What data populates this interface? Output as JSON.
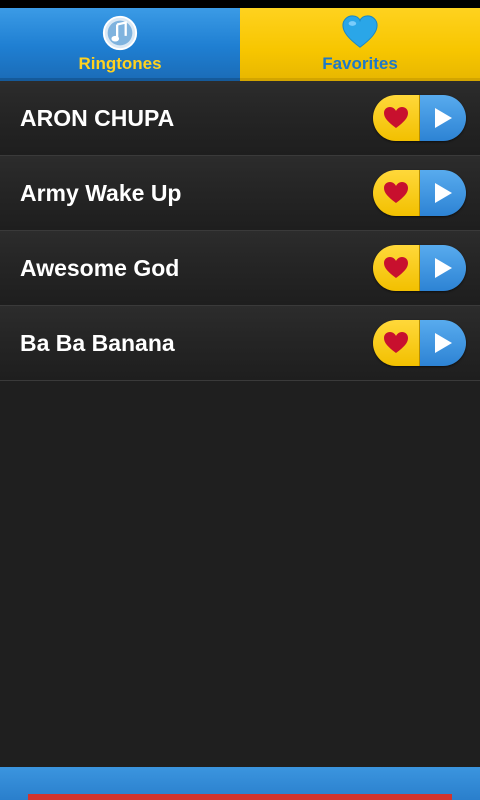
{
  "tabs": {
    "ringtones": {
      "label": "Ringtones",
      "icon": "music-note-icon"
    },
    "favorites": {
      "label": "Favorites",
      "icon": "heart-icon"
    }
  },
  "ringtones": [
    {
      "title": "ARON CHUPA"
    },
    {
      "title": "Army Wake Up"
    },
    {
      "title": "Awesome God"
    },
    {
      "title": "Ba Ba Banana"
    }
  ],
  "colors": {
    "blue_accent": "#1f7fd2",
    "yellow_accent": "#f7c600",
    "heart_red": "#c8102e",
    "background": "#1f1f1f"
  }
}
